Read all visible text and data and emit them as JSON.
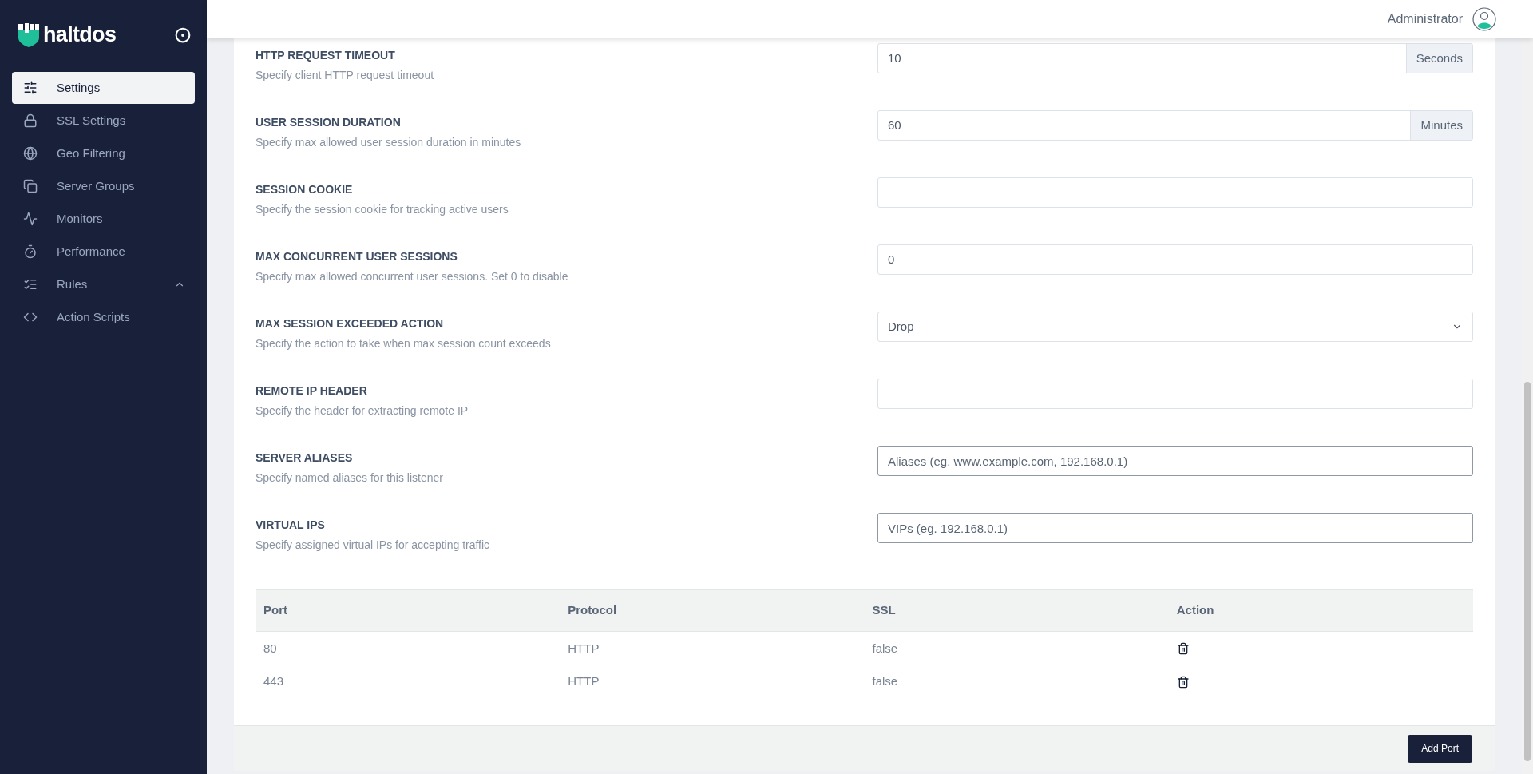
{
  "brand": {
    "name": "haltdos"
  },
  "sidebar": {
    "items": [
      {
        "label": "Settings",
        "selected": true
      },
      {
        "label": "SSL Settings",
        "selected": false
      },
      {
        "label": "Geo Filtering",
        "selected": false
      },
      {
        "label": "Server Groups",
        "selected": false
      },
      {
        "label": "Monitors",
        "selected": false
      },
      {
        "label": "Performance",
        "selected": false
      },
      {
        "label": "Rules",
        "selected": false,
        "expanded": true
      },
      {
        "label": "Action Scripts",
        "selected": false
      }
    ]
  },
  "header": {
    "user": "Administrator"
  },
  "settings": [
    {
      "title": "HTTP REQUEST TIMEOUT",
      "description": "Specify client HTTP request timeout",
      "kind": "addon",
      "value": "10",
      "suffix": "Seconds"
    },
    {
      "title": "USER SESSION DURATION",
      "description": "Specify max allowed user session duration in minutes",
      "kind": "addon",
      "value": "60",
      "suffix": "Minutes"
    },
    {
      "title": "SESSION COOKIE",
      "description": "Specify the session cookie for tracking active users",
      "kind": "text"
    },
    {
      "title": "MAX CONCURRENT USER SESSIONS",
      "description": "Specify max allowed concurrent user sessions. Set 0 to disable",
      "kind": "text",
      "value": "0"
    },
    {
      "title": "MAX SESSION EXCEEDED ACTION",
      "description": "Specify the action to take when max session count exceeds",
      "kind": "select",
      "value": "Drop"
    },
    {
      "title": "REMOTE IP HEADER",
      "description": "Specify the header for extracting remote IP",
      "kind": "text"
    },
    {
      "title": "SERVER ALIASES",
      "description": "Specify named aliases for this listener",
      "kind": "tags",
      "placeholder": "Aliases (eg. www.example.com, 192.168.0.1)"
    },
    {
      "title": "VIRTUAL IPS",
      "description": "Specify assigned virtual IPs for accepting traffic",
      "kind": "tags",
      "placeholder": "VIPs (eg. 192.168.0.1)"
    }
  ],
  "ports_table": {
    "columns": [
      "Port",
      "Protocol",
      "SSL",
      "Action"
    ],
    "rows": [
      {
        "port": "80",
        "protocol": "HTTP",
        "ssl": "false"
      },
      {
        "port": "443",
        "protocol": "HTTP",
        "ssl": "false"
      }
    ]
  },
  "add_button": "Add Port"
}
